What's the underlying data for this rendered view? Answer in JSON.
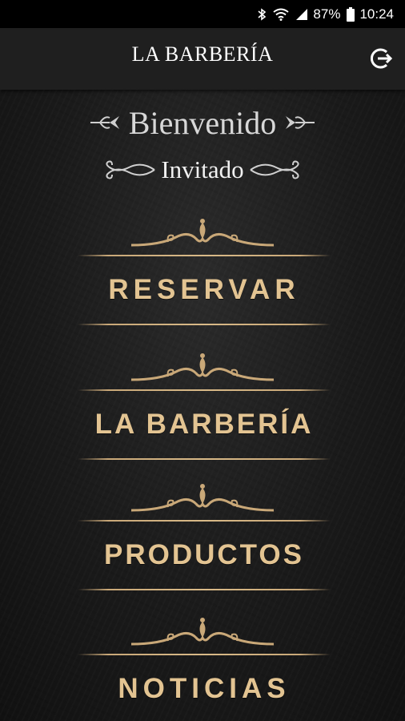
{
  "status_bar": {
    "battery_percent": "87%",
    "time": "10:24",
    "icons": [
      "bluetooth-icon",
      "wifi-icon",
      "signal-icon",
      "battery-icon"
    ]
  },
  "app_bar": {
    "title": "LA BARBERÍA",
    "action_icon": "logout-icon"
  },
  "welcome": {
    "greeting": "Bienvenido",
    "user": "Invitado"
  },
  "menu": [
    {
      "label": "RESERVAR"
    },
    {
      "label": "LA BARBERÍA"
    },
    {
      "label": "PRODUCTOS"
    },
    {
      "label": "NOTICIAS"
    }
  ],
  "colors": {
    "accent_gold": "#e3c492",
    "background": "#1a1a1a",
    "appbar": "#1f1f1f"
  }
}
